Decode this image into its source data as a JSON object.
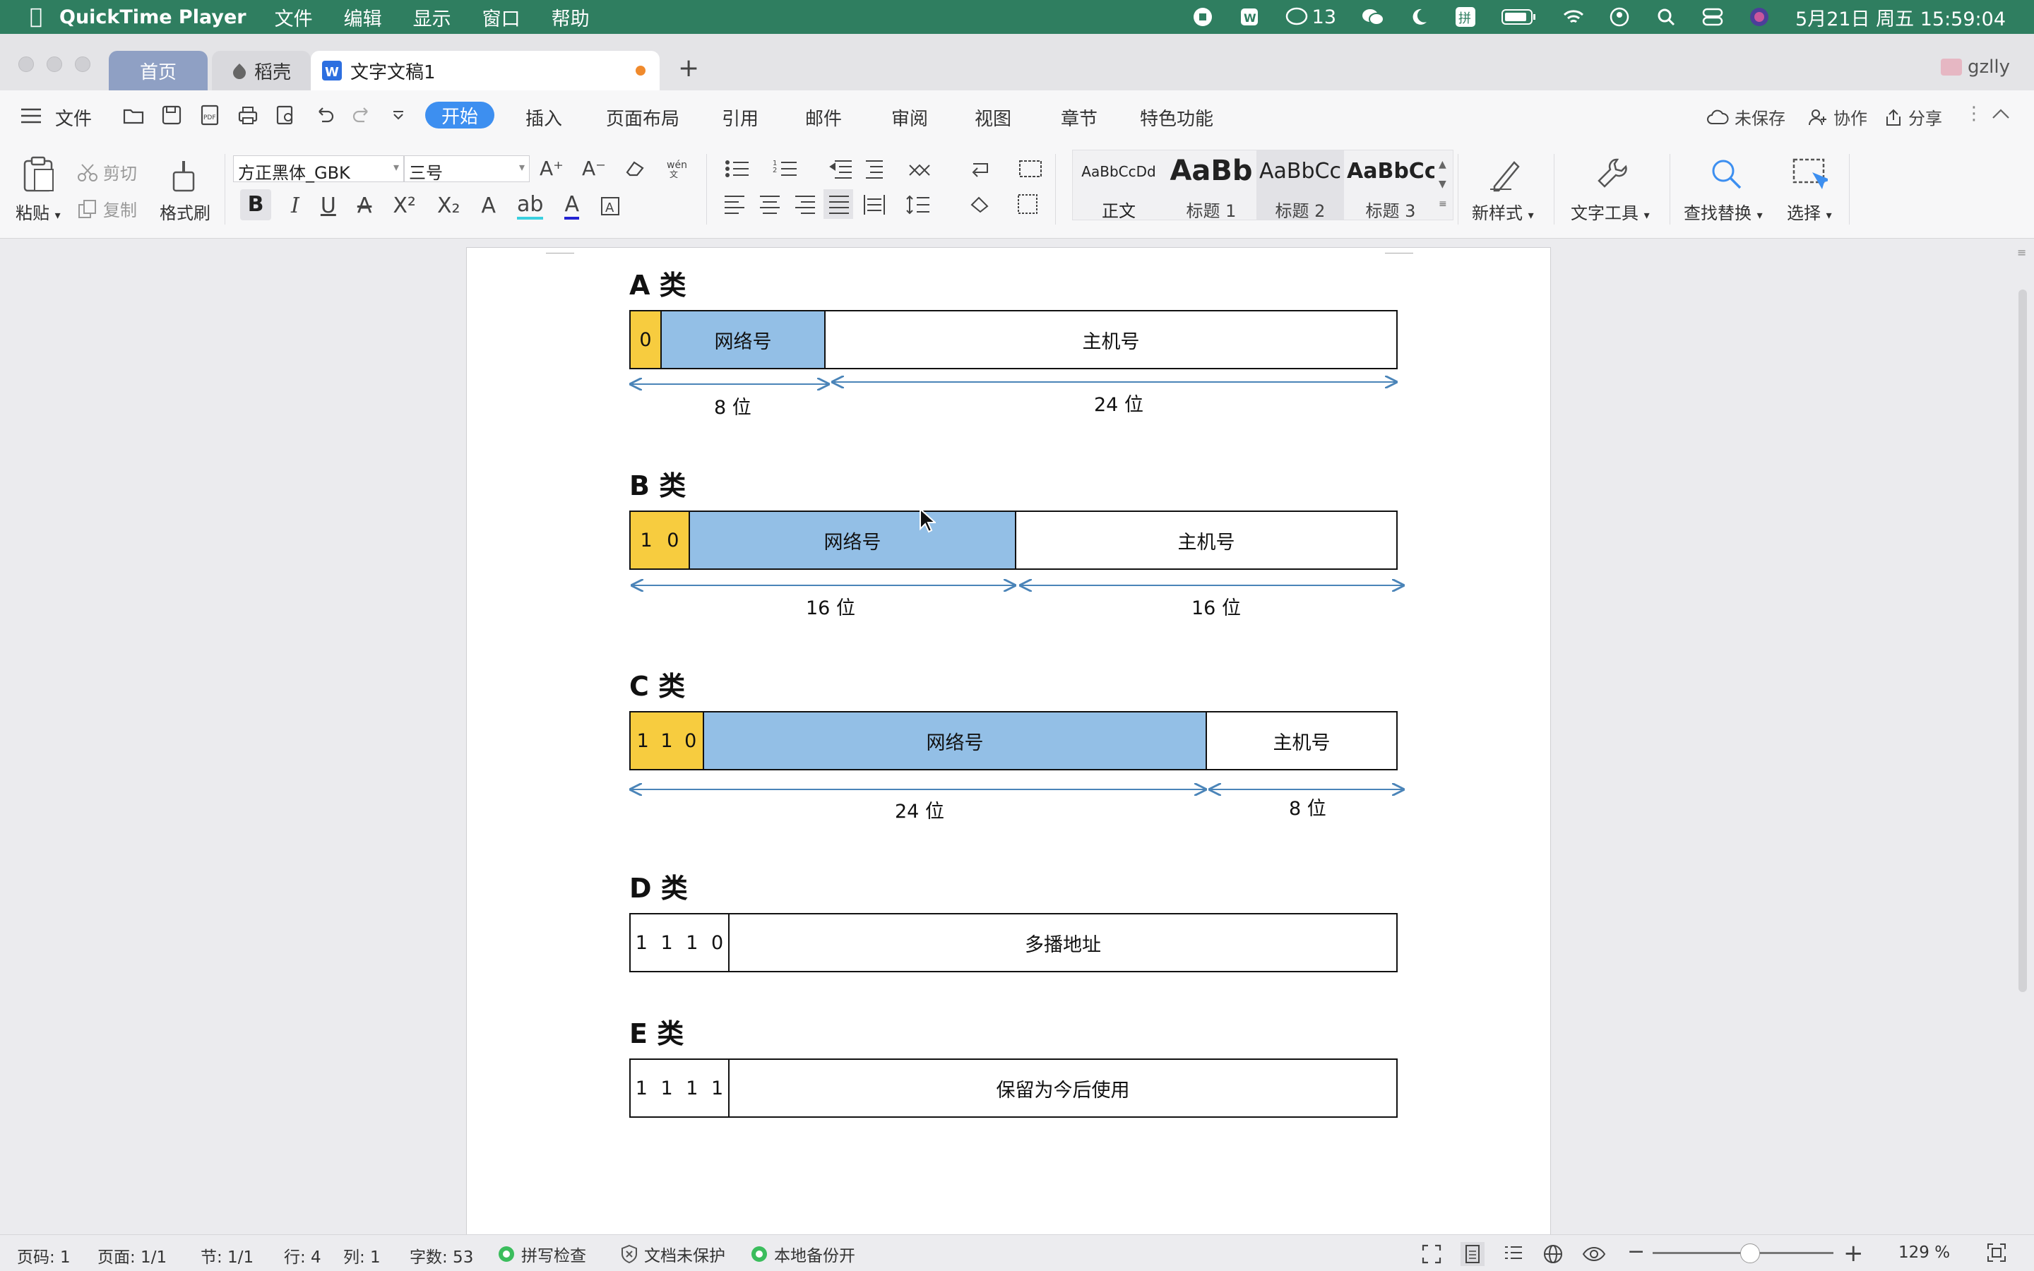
{
  "menubar": {
    "app": "QuickTime Player",
    "menus": [
      "文件",
      "编辑",
      "显示",
      "窗口",
      "帮助"
    ],
    "notify_count": "13",
    "datetime": "5月21日 周五 15:59:04"
  },
  "tabs": {
    "home": "首页",
    "docer": "稻壳",
    "doc": "文字文稿1",
    "user": "gzlly"
  },
  "toolbar": {
    "file": "文件",
    "menu_tabs": [
      "开始",
      "插入",
      "页面布局",
      "引用",
      "邮件",
      "审阅",
      "视图",
      "章节",
      "特色功能"
    ],
    "unsaved": "未保存",
    "collab": "协作",
    "share": "分享"
  },
  "ribbon": {
    "paste": "粘贴",
    "cut": "剪切",
    "copy": "复制",
    "format_painter": "格式刷",
    "font": "方正黑体_GBK",
    "size": "三号",
    "styles": [
      {
        "preview": "AaBbCcDd",
        "name": "正文"
      },
      {
        "preview": "AaBb",
        "name": "标题 1"
      },
      {
        "preview": "AaBbCc",
        "name": "标题 2"
      },
      {
        "preview": "AaBbCc",
        "name": "标题 3"
      }
    ],
    "new_style": "新样式",
    "text_tools": "文字工具",
    "find_replace": "查找替换",
    "select": "选择"
  },
  "doc": {
    "a": {
      "title": "A 类",
      "bits": "0",
      "net": "网络号",
      "host": "主机号",
      "net_len": "8 位",
      "host_len": "24 位"
    },
    "b": {
      "title": "B 类",
      "bits": "1 0",
      "net": "网络号",
      "host": "主机号",
      "net_len": "16 位",
      "host_len": "16 位"
    },
    "c": {
      "title": "C 类",
      "bits": "1 1 0",
      "net": "网络号",
      "host": "主机号",
      "net_len": "24 位",
      "host_len": "8 位"
    },
    "d": {
      "title": "D 类",
      "bits": "1 1 1 0",
      "rest": "多播地址"
    },
    "e": {
      "title": "E 类",
      "bits": "1 1 1 1",
      "rest": "保留为今后使用"
    }
  },
  "status": {
    "page_no": "页码: 1",
    "pages": "页面: 1/1",
    "section": "节: 1/1",
    "row": "行: 4",
    "col": "列: 1",
    "words": "字数: 53",
    "spell": "拼写检查",
    "protect": "文档未保护",
    "backup": "本地备份开",
    "zoom": "129 %"
  },
  "colors": {
    "menubar": "#2f7e60",
    "start_tab": "#3d8ff0",
    "yellow": "#f7cc3f",
    "blue": "#93bfe6",
    "arrow": "#4a84b8"
  }
}
